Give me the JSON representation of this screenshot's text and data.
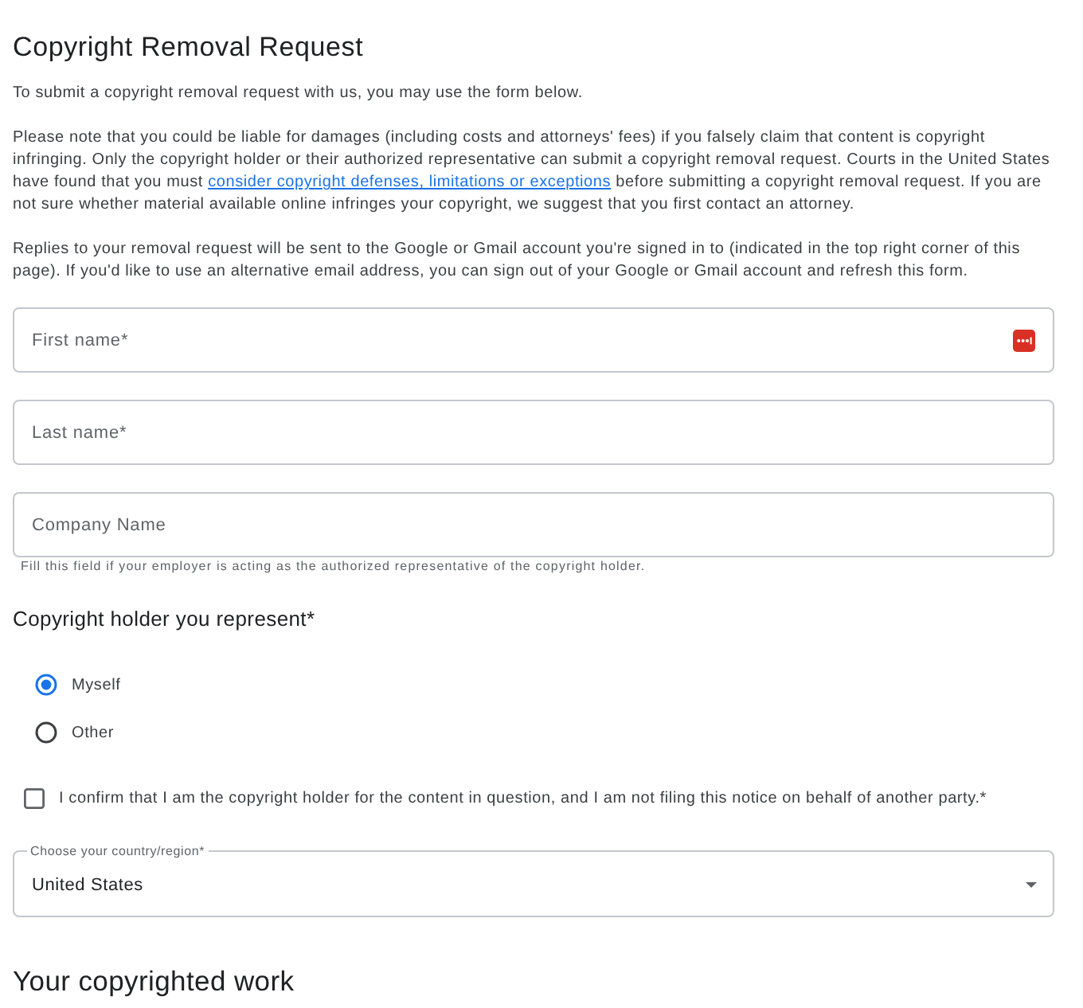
{
  "title": "Copyright Removal Request",
  "intro": "To submit a copyright removal request with us, you may use the form below.",
  "notice": {
    "before": "Please note that you could be liable for damages (including costs and attorneys' fees) if you falsely claim that content is copyright infringing. Only the copyright holder or their authorized representative can submit a copyright removal request. Courts in the United States have found that you must",
    "link": "consider copyright defenses, limitations or exceptions",
    "after": "before submitting a copyright removal request. If you are not sure whether material available online infringes your copyright, we suggest that you first contact an attorney."
  },
  "replies_note": "Replies to your removal request will be sent to the Google or Gmail account you're signed in to (indicated in the top right corner of this page). If you'd like to use an alternative email address, you can sign out of your Google or Gmail account and refresh this form.",
  "fields": [
    {
      "placeholder": "First name*",
      "autofill_badge": true
    },
    {
      "placeholder": "Last name*",
      "autofill_badge": false
    },
    {
      "placeholder": "Company Name",
      "autofill_badge": false,
      "hint": "Fill this field if your employer is acting as the authorized representative of the copyright holder."
    }
  ],
  "holder": {
    "label": "Copyright holder you represent*",
    "options": [
      {
        "label": "Myself",
        "selected": true
      },
      {
        "label": "Other",
        "selected": false
      }
    ]
  },
  "confirm": {
    "label": "I confirm that I am the copyright holder for the content in question, and I am not filing this notice on behalf of another party.*",
    "checked": false
  },
  "country": {
    "label": "Choose your country/region*",
    "value": "United States"
  },
  "next_section": "Your copyrighted work"
}
